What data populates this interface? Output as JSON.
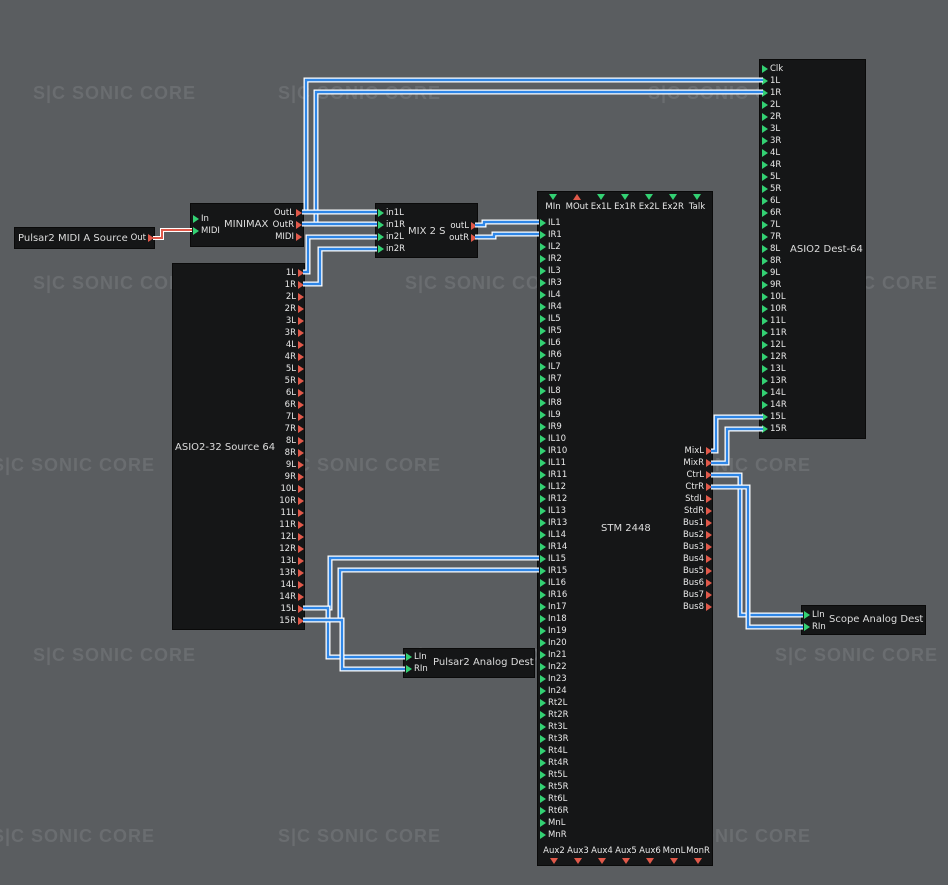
{
  "watermark": {
    "text": "S|C  SONIC CORE"
  },
  "modules": {
    "midi_source": {
      "title": "Pulsar2 MIDI A Source",
      "outputs": [
        "Out"
      ]
    },
    "minimax": {
      "title": "MINIMAX",
      "inputs": [
        "In",
        "MIDI"
      ],
      "outputs": [
        "OutL",
        "OutR",
        "MIDI"
      ]
    },
    "mix2s": {
      "title": "MIX 2 S",
      "inputs": [
        "in1L",
        "in1R",
        "in2L",
        "in2R"
      ],
      "outputs": [
        "outL",
        "outR"
      ]
    },
    "asio_source": {
      "title": "ASIO2-32 Source 64",
      "outputs": [
        "1L",
        "1R",
        "2L",
        "2R",
        "3L",
        "3R",
        "4L",
        "4R",
        "5L",
        "5R",
        "6L",
        "6R",
        "7L",
        "7R",
        "8L",
        "8R",
        "9L",
        "9R",
        "10L",
        "10R",
        "11L",
        "11R",
        "12L",
        "12R",
        "13L",
        "13R",
        "14L",
        "14R",
        "15L",
        "15R"
      ]
    },
    "stm": {
      "title": "STM 2448",
      "top_ports": [
        {
          "label": "MIn",
          "kind": "in"
        },
        {
          "label": "MOut",
          "kind": "out"
        },
        {
          "label": "Ex1L",
          "kind": "in"
        },
        {
          "label": "Ex1R",
          "kind": "in"
        },
        {
          "label": "Ex2L",
          "kind": "in"
        },
        {
          "label": "Ex2R",
          "kind": "in"
        },
        {
          "label": "Talk",
          "kind": "in"
        }
      ],
      "inputs": [
        "IL1",
        "IR1",
        "IL2",
        "IR2",
        "IL3",
        "IR3",
        "IL4",
        "IR4",
        "IL5",
        "IR5",
        "IL6",
        "IR6",
        "IL7",
        "IR7",
        "IL8",
        "IR8",
        "IL9",
        "IR9",
        "IL10",
        "IR10",
        "IL11",
        "IR11",
        "IL12",
        "IR12",
        "IL13",
        "IR13",
        "IL14",
        "IR14",
        "IL15",
        "IR15",
        "IL16",
        "IR16",
        "In17",
        "In18",
        "In19",
        "In20",
        "In21",
        "In22",
        "In23",
        "In24",
        "Rt2L",
        "Rt2R",
        "Rt3L",
        "Rt3R",
        "Rt4L",
        "Rt4R",
        "Rt5L",
        "Rt5R",
        "Rt6L",
        "Rt6R",
        "MnL",
        "MnR"
      ],
      "outputs": [
        "MixL",
        "MixR",
        "CtrL",
        "CtrR",
        "StdL",
        "StdR",
        "Bus1",
        "Bus2",
        "Bus3",
        "Bus4",
        "Bus5",
        "Bus6",
        "Bus7",
        "Bus8"
      ],
      "bottom_ports": [
        "Aux2",
        "Aux3",
        "Aux4",
        "Aux5",
        "Aux6",
        "MonL",
        "MonR"
      ]
    },
    "asio_dest": {
      "title": "ASIO2 Dest-64",
      "inputs": [
        "Clk",
        "1L",
        "1R",
        "2L",
        "2R",
        "3L",
        "3R",
        "4L",
        "4R",
        "5L",
        "5R",
        "6L",
        "6R",
        "7L",
        "7R",
        "8L",
        "8R",
        "9L",
        "9R",
        "10L",
        "10R",
        "11L",
        "11R",
        "12L",
        "12R",
        "13L",
        "13R",
        "14L",
        "14R",
        "15L",
        "15R"
      ]
    },
    "pulsar_dest": {
      "title": "Pulsar2 Analog Dest",
      "inputs": [
        "LIn",
        "RIn"
      ]
    },
    "scope_dest": {
      "title": "Scope Analog Dest",
      "inputs": [
        "LIn",
        "RIn"
      ]
    }
  },
  "colors": {
    "background": "#5a5d60",
    "module": "#151617",
    "input_port": "#33d173",
    "output_port": "#e0594a",
    "audio_wire": "#2f86e6",
    "midi_wire": "#e0594a"
  }
}
